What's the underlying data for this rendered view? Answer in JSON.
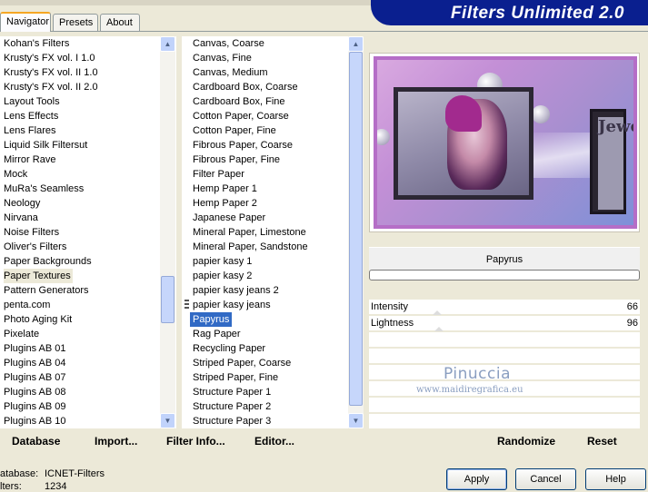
{
  "title": "Filters Unlimited 2.0",
  "tabs": [
    "Navigator",
    "Presets",
    "About"
  ],
  "categories": [
    "Kohan's Filters",
    "Krusty's FX vol. I 1.0",
    "Krusty's FX vol. II 1.0",
    "Krusty's FX vol. II 2.0",
    "Layout Tools",
    "Lens Effects",
    "Lens Flares",
    "Liquid Silk Filtersut",
    "Mirror Rave",
    "Mock",
    "MuRa's Seamless",
    "Neology",
    "Nirvana",
    "Noise Filters",
    "Oliver's Filters",
    "Paper Backgrounds",
    "Paper Textures",
    "Pattern Generators",
    "penta.com",
    "Photo Aging Kit",
    "Pixelate",
    "Plugins AB 01",
    "Plugins AB 04",
    "Plugins AB 07",
    "Plugins AB 08",
    "Plugins AB 09",
    "Plugins AB 10"
  ],
  "selected_category": "Paper Textures",
  "filters": [
    "Canvas, Coarse",
    "Canvas, Fine",
    "Canvas, Medium",
    "Cardboard Box, Coarse",
    "Cardboard Box, Fine",
    "Cotton Paper, Coarse",
    "Cotton Paper, Fine",
    "Fibrous Paper, Coarse",
    "Fibrous Paper, Fine",
    "Filter Paper",
    "Hemp Paper 1",
    "Hemp Paper 2",
    "Japanese Paper",
    "Mineral Paper, Limestone",
    "Mineral Paper, Sandstone",
    "papier kasy 1",
    "papier kasy 2",
    "papier kasy jeans 2",
    "papier kasy jeans",
    "Papyrus",
    "Rag Paper",
    "Recycling Paper",
    "Striped Paper, Coarse",
    "Striped Paper, Fine",
    "Structure Paper 1",
    "Structure Paper 2",
    "Structure Paper 3"
  ],
  "selected_filter": "Papyrus",
  "preview_text": "Jewe",
  "filter_name": "Papyrus",
  "params": [
    {
      "label": "Intensity",
      "value": "66",
      "level": 66
    },
    {
      "label": "Lightness",
      "value": "96",
      "level": 96
    }
  ],
  "watermark": {
    "line1": "Pinuccia",
    "line2": "www.maidiregrafica.eu"
  },
  "link_buttons": [
    "Database",
    "Import...",
    "Filter Info...",
    "Editor..."
  ],
  "right_links": [
    "Randomize",
    "Reset"
  ],
  "status": {
    "database_label": "atabase:",
    "database_value": "ICNET-Filters",
    "filters_label": "lters:",
    "filters_value": "1234"
  },
  "buttons": {
    "apply": "Apply",
    "cancel": "Cancel",
    "help": "Help"
  }
}
